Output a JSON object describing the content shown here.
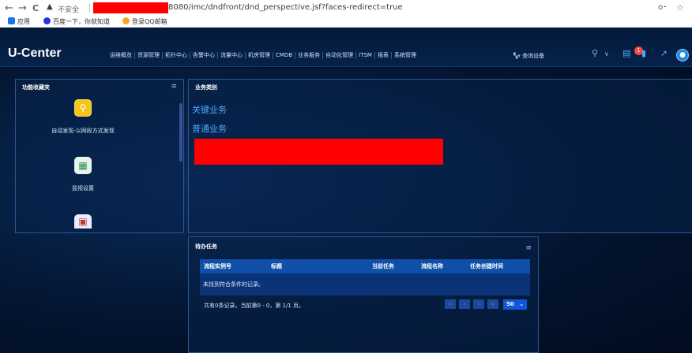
{
  "browser": {
    "back": "←",
    "forward": "→",
    "reload": "C",
    "warning_icon": "▲",
    "insecure_label": "不安全",
    "url": "8080/imc/dndfront/dnd_perspective.jsf?faces-redirect=true",
    "key_icon": "o⁃",
    "star_icon": "☆"
  },
  "bookmarks": [
    {
      "label": "应用",
      "icon": "apps-icon",
      "color": "#1a73e8"
    },
    {
      "label": "百度一下，你就知道",
      "icon": "baidu-icon",
      "color": "#2932e1"
    },
    {
      "label": "登录QQ邮箱",
      "icon": "qqmail-icon",
      "color": "#f5a623"
    }
  ],
  "header": {
    "logo": "U-Center",
    "menu": [
      "运维概览",
      "资源管理",
      "拓扑中心",
      "告警中心",
      "流量中心",
      "机房管理",
      "CMDB",
      "业务服务",
      "自动化管理",
      "ITSM",
      "报表",
      "系统管理"
    ],
    "query_device": "查询设备",
    "notification_count": "1",
    "avatar_icon": "user-icon"
  },
  "favorites_panel": {
    "title": "功能收藏夹",
    "menu_icon": "≡",
    "items": [
      {
        "label": "自动发现-以网段方式发现",
        "icon": "discover-icon",
        "color": "#f5c518"
      },
      {
        "label": "监视设置",
        "icon": "monitor-settings-icon",
        "color": "#e8f4e8"
      },
      {
        "label": "",
        "icon": "report-icon",
        "color": "#e8eefc"
      }
    ]
  },
  "business_panel": {
    "title": "业务类别",
    "links": [
      "关键业务",
      "普通业务"
    ]
  },
  "tasks_panel": {
    "title": "待办任务",
    "menu_icon": "≡",
    "columns": [
      "流程实例号",
      "标题",
      "当前任务",
      "流程名称",
      "任务创建时间"
    ],
    "empty_text": "未找到符合条件的记录。",
    "pager_text": "共有0条记录，当前第0 - 0，第 1/1 页。",
    "page_size": "50",
    "pager_buttons": [
      "«",
      "‹",
      "›",
      "»"
    ]
  },
  "colors": {
    "accent": "#0f58d8",
    "link": "#4aa8ff",
    "redacted": "#ff0000"
  }
}
